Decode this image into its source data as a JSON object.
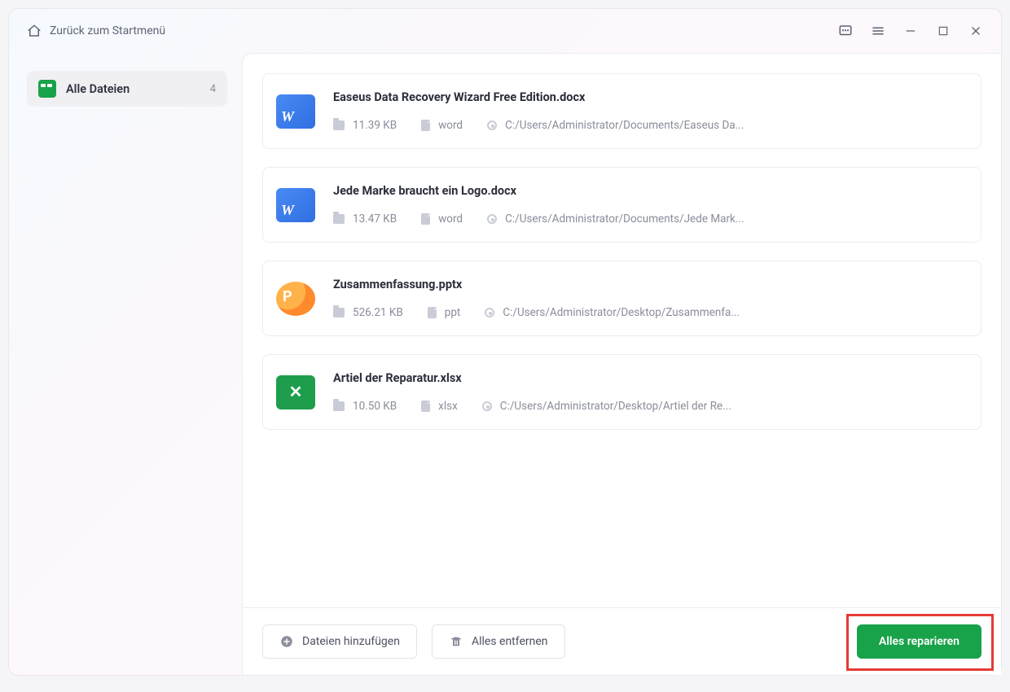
{
  "titlebar": {
    "back_label": "Zurück zum Startmenü"
  },
  "sidebar": {
    "items": [
      {
        "label": "Alle Dateien",
        "count": "4"
      }
    ]
  },
  "files": [
    {
      "name": "Easeus Data Recovery Wizard Free Edition.docx",
      "size": "11.39 KB",
      "type": "word",
      "path": "C:/Users/Administrator/Documents/Easeus Da...",
      "icon": "word"
    },
    {
      "name": "Jede Marke braucht ein Logo.docx",
      "size": "13.47 KB",
      "type": "word",
      "path": "C:/Users/Administrator/Documents/Jede Mark...",
      "icon": "word"
    },
    {
      "name": "Zusammenfassung.pptx",
      "size": "526.21 KB",
      "type": "ppt",
      "path": "C:/Users/Administrator/Desktop/Zusammenfa...",
      "icon": "ppt"
    },
    {
      "name": "Artiel der Reparatur.xlsx",
      "size": "10.50 KB",
      "type": "xlsx",
      "path": "C:/Users/Administrator/Desktop/Artiel der Re...",
      "icon": "xls"
    }
  ],
  "footer": {
    "add_label": "Dateien hinzufügen",
    "remove_label": "Alles entfernen",
    "repair_label": "Alles reparieren"
  },
  "highlight": {
    "target": "repair-all-button"
  }
}
